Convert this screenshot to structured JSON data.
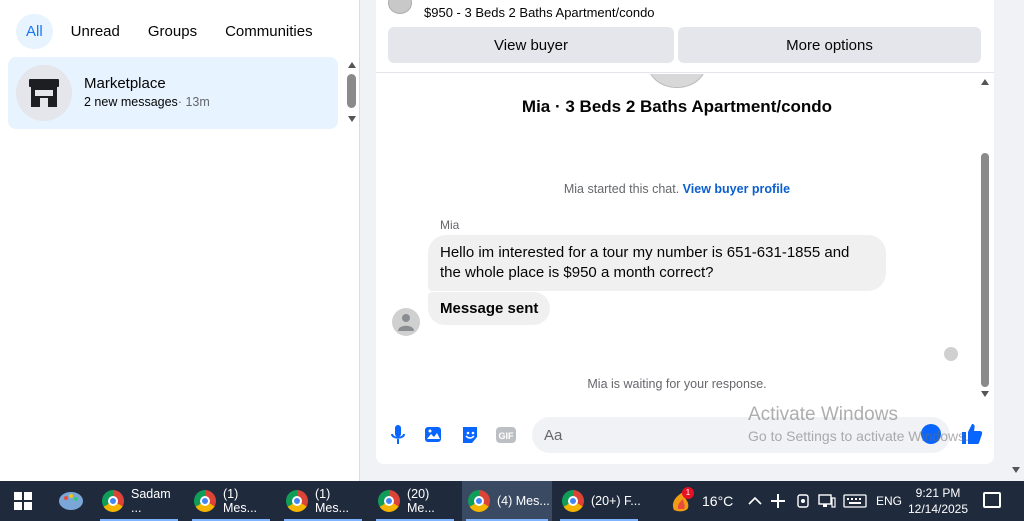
{
  "filters": [
    "All",
    "Unread",
    "Groups",
    "Communities"
  ],
  "conversation": {
    "name": "Marketplace",
    "subtitle": "2 new messages",
    "time": "· 13m"
  },
  "listing": {
    "text": "$950 - 3 Beds 2 Baths Apartment/condo"
  },
  "buttons": {
    "view_buyer": "View buyer",
    "more_options": "More options"
  },
  "chat": {
    "title": "Mia · 3 Beds 2 Baths Apartment/condo",
    "started_text": "Mia started this chat.",
    "started_link": "View buyer profile",
    "sender": "Mia",
    "message1": "Hello im interested for a tour my number is 651-631-1855 and the whole place is $950 a month correct?",
    "message2": "Message sent",
    "waiting": "Mia is waiting for your response."
  },
  "composer": {
    "placeholder": "Aa",
    "icons": [
      "microphone-icon",
      "photo-icon",
      "sticker-icon",
      "gif-icon",
      "emoji-icon",
      "like-icon"
    ]
  },
  "watermark": {
    "line1": "Activate Windows",
    "line2": "Go to Settings to activate Windows."
  },
  "taskbar": {
    "apps": [
      {
        "label": "Sadam ...",
        "active": false
      },
      {
        "label": "(1) Mes...",
        "active": false
      },
      {
        "label": "(1) Mes...",
        "active": false
      },
      {
        "label": "(20) Me...",
        "active": false
      },
      {
        "label": "(4) Mes...",
        "active": true
      },
      {
        "label": "(20+) F...",
        "active": false
      }
    ],
    "weather_badge": "1",
    "temperature": "16°C",
    "language": "ENG",
    "time": "9:21 PM",
    "date": "12/14/2025"
  },
  "colors": {
    "accent": "#1877f2",
    "selected_bg": "#e7f3ff",
    "bubble_bg": "#f0f0f0",
    "taskbar_bg": "#1f2b3d"
  }
}
